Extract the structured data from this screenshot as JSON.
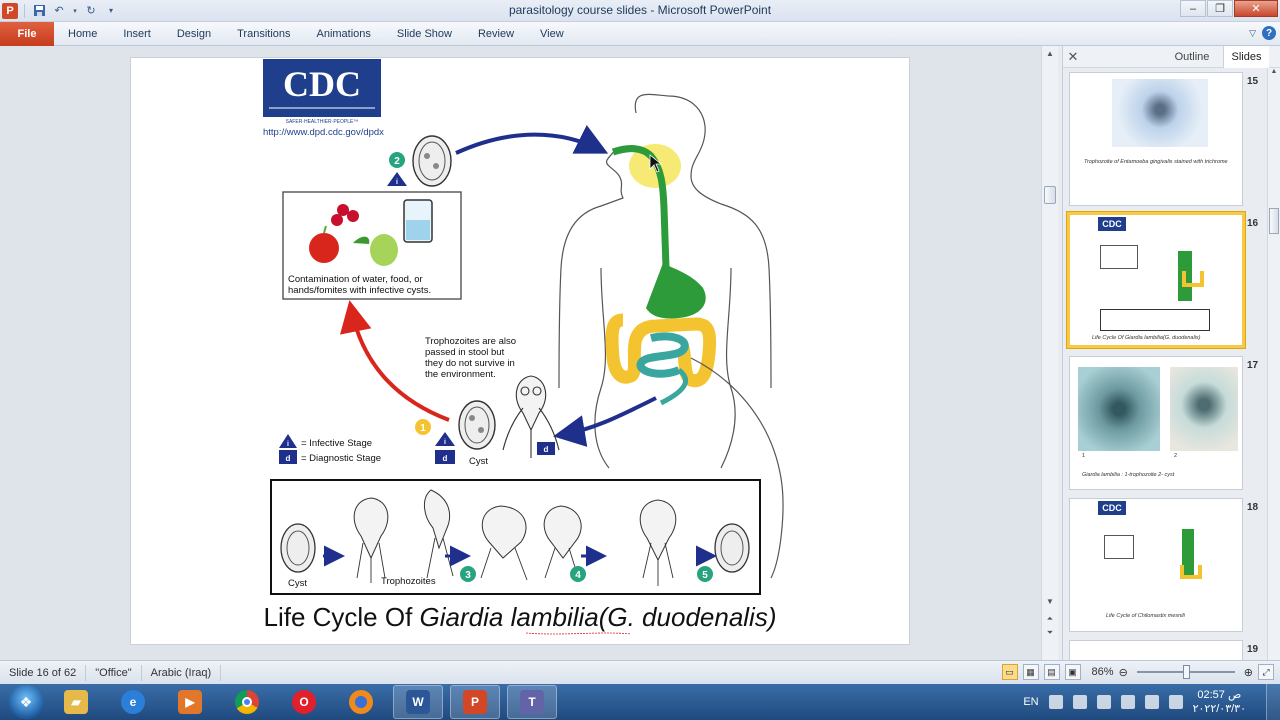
{
  "window": {
    "title": "parasitology course slides  -  Microsoft PowerPoint"
  },
  "ribbon": {
    "file_label": "File",
    "tabs": [
      "Home",
      "Insert",
      "Design",
      "Transitions",
      "Animations",
      "Slide Show",
      "Review",
      "View"
    ]
  },
  "slide": {
    "logo_text": "CDC",
    "logo_tagline": "SAFER·HEALTHIER·PEOPLE™",
    "url": "http://www.dpd.cdc.gov/dpdx",
    "contamination_text_1": "Contamination of water, food, or",
    "contamination_text_2": "hands/fomites with infective cysts.",
    "troph_note": [
      "Trophozoites are also",
      "passed in stool but",
      "they do not survive in",
      "the environment."
    ],
    "legend_infective": "= Infective Stage",
    "legend_diagnostic": "= Diagnostic Stage",
    "legend_i": "i",
    "legend_d": "d",
    "cyst_label": "Cyst",
    "step_1": "1",
    "step_2": "2",
    "step_3": "3",
    "step_4": "4",
    "step_5": "5",
    "box_cyst_label": "Cyst",
    "box_troph_label": "Trophozoites",
    "title_prefix": "Life Cycle Of ",
    "title_italic": "Giardia lambilia(G. duodenalis)"
  },
  "pane": {
    "tab_outline": "Outline",
    "tab_slides": "Slides",
    "thumbnails": [
      {
        "num": "15",
        "caption": "Trophozoite of Entamoeba gingivalis  stained with trichrome"
      },
      {
        "num": "16",
        "caption": "Life Cycle Of Giardia lambilia(G. duodenalis)",
        "logo": "CDC"
      },
      {
        "num": "17",
        "caption": "Giardia lambilia : 1-trophozoite      2- cyst",
        "label_1": "1",
        "label_2": "2"
      },
      {
        "num": "18",
        "caption": "Life Cycle of  Chilomastix mesnili",
        "logo": "CDC"
      },
      {
        "num": "19"
      }
    ]
  },
  "status": {
    "slide_info": "Slide 16 of 62",
    "theme": "\"Office\"",
    "language": "Arabic (Iraq)",
    "zoom": "86%",
    "zoom_level": 0.5
  },
  "taskbar": {
    "language": "EN",
    "time": "02:57 ص",
    "date": "٢٠٢٢/٠٣/٣٠"
  },
  "colors": {
    "cdc_blue": "#1f3f8c",
    "arrow_red": "#d9261c",
    "badge_teal": "#27a37f",
    "gut_green": "#2e9b3b",
    "gut_yellow": "#f4c430",
    "gut_teal": "#3aa6a0",
    "selection": "#f7c948"
  }
}
